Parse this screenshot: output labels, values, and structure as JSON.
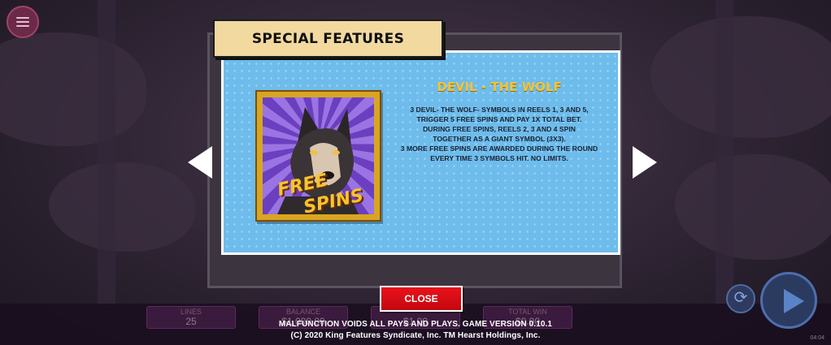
{
  "menu": {
    "icon": "hamburger-menu-icon"
  },
  "dialog": {
    "header_title": "SPECIAL FEATURES",
    "feature_title": "DEVIL - THE WOLF",
    "symbol": {
      "icon": "wolf-free-spins-symbol",
      "label_line1": "FREE",
      "label_line2": "SPINS"
    },
    "description_lines": [
      "3 DEVIL- THE WOLF- SYMBOLS IN REELS 1, 3 AND 5,",
      "TRIGGER 5 FREE SPINS AND PAY 1X TOTAL BET.",
      "DURING FREE SPINS, REELS 2, 3 AND 4 SPIN",
      "TOGETHER AS A GIANT SYMBOL (3X3).",
      "3 MORE FREE SPINS ARE AWARDED DURING THE ROUND",
      "EVERY TIME 3 SYMBOLS HIT. NO LIMITS."
    ],
    "close_label": "CLOSE",
    "prev_icon": "arrow-left-icon",
    "next_icon": "arrow-right-icon"
  },
  "stats": {
    "lines_label": "LINES",
    "lines_value": "25",
    "balance_label": "BALANCE",
    "balance_value": "$1,000.00",
    "bet_value": "$1.00",
    "total_win_label": "TOTAL WIN",
    "total_win_value": "$0.00"
  },
  "footer": {
    "line1": "MALFUNCTION VOIDS ALL PAYS AND PLAYS. GAME VERSION 0.10.1",
    "line2": "(C) 2020 King Features Syndicate, Inc. TM Hearst Holdings, Inc.",
    "clock": "04:04"
  },
  "controls": {
    "autoplay_icon": "autoplay-icon",
    "spin_icon": "spin-play-icon"
  },
  "colors": {
    "panel_bg": "#6dbcec",
    "title": "#f1c43a",
    "close_bg": "#e8131c",
    "banner_bg": "#f2d9a0"
  }
}
